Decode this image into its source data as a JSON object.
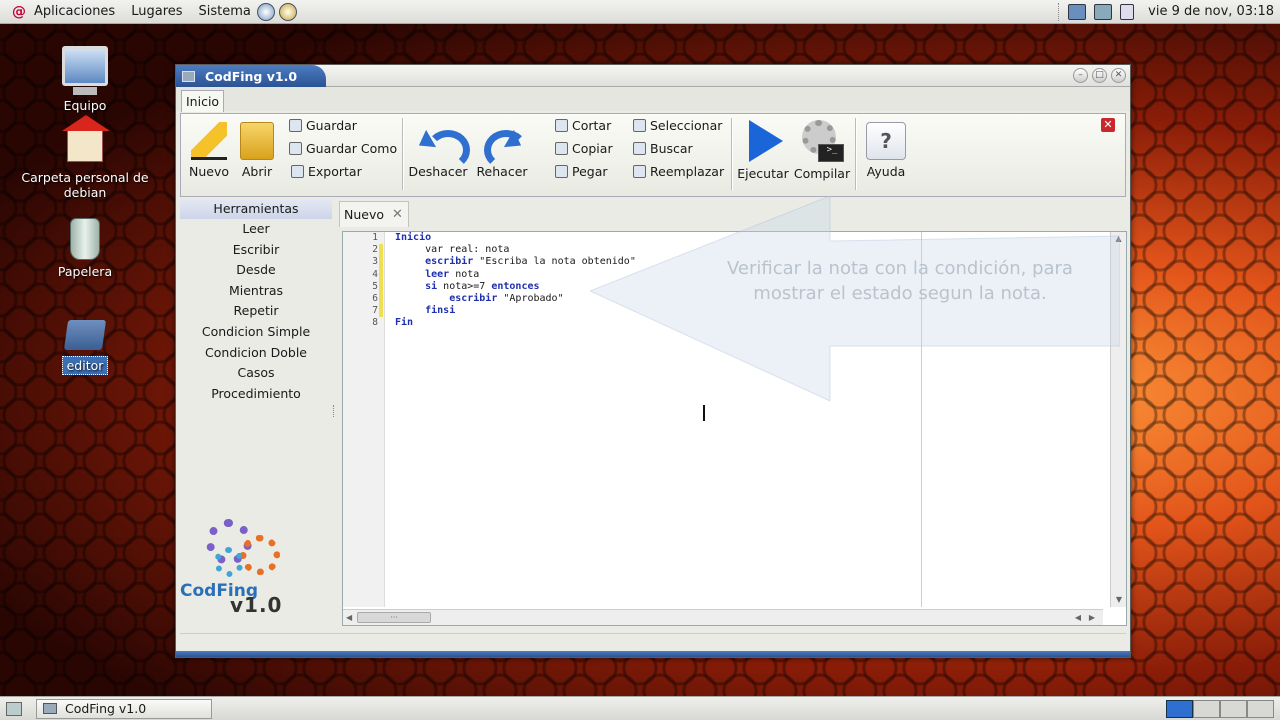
{
  "top_panel": {
    "menu_applications": "Aplicaciones",
    "menu_places": "Lugares",
    "menu_system": "Sistema",
    "clock": "vie  9 de nov, 03:18"
  },
  "desktop_icons": {
    "computer": "Equipo",
    "home": "Carpeta personal de debian",
    "trash": "Papelera",
    "editor": "editor"
  },
  "window": {
    "title": "CodFing v1.0",
    "ribbon_tab": "Inicio",
    "buttons": {
      "new": "Nuevo",
      "open": "Abrir",
      "save": "Guardar",
      "save_as": "Guardar Como",
      "export": "Exportar",
      "undo": "Deshacer",
      "redo": "Rehacer",
      "cut": "Cortar",
      "copy": "Copiar",
      "paste": "Pegar",
      "select": "Seleccionar",
      "search": "Buscar",
      "replace": "Reemplazar",
      "run": "Ejecutar",
      "compile": "Compilar",
      "help": "Ayuda"
    }
  },
  "sidebar": {
    "header": "Herramientas",
    "items": [
      {
        "label": "Leer"
      },
      {
        "label": "Escribir"
      },
      {
        "label": "Desde"
      },
      {
        "label": "Mientras"
      },
      {
        "label": "Repetir"
      },
      {
        "label": "Condicion Simple"
      },
      {
        "label": "Condicion Doble"
      },
      {
        "label": "Casos"
      },
      {
        "label": "Procedimiento"
      }
    ],
    "logo_name": "CodFing",
    "logo_version": "v1.0"
  },
  "editor": {
    "tab": "Nuevo",
    "line_numbers": [
      "1",
      "2",
      "3",
      "4",
      "5",
      "6",
      "7",
      "8"
    ],
    "lines": [
      [
        {
          "t": "Inicio",
          "k": true
        }
      ],
      [
        {
          "t": "     var real: nota",
          "k": false
        }
      ],
      [
        {
          "t": "     ",
          "k": false
        },
        {
          "t": "escribir",
          "k": true
        },
        {
          "t": " \"Escriba la nota obtenido\"",
          "k": false
        }
      ],
      [
        {
          "t": "     ",
          "k": false
        },
        {
          "t": "leer",
          "k": true
        },
        {
          "t": " nota",
          "k": false
        }
      ],
      [
        {
          "t": "     ",
          "k": false
        },
        {
          "t": "si",
          "k": true
        },
        {
          "t": " nota>=7 ",
          "k": false
        },
        {
          "t": "entonces",
          "k": true
        }
      ],
      [
        {
          "t": "         ",
          "k": false
        },
        {
          "t": "escribir",
          "k": true
        },
        {
          "t": " \"Aprobado\"",
          "k": false
        }
      ],
      [
        {
          "t": "     ",
          "k": false
        },
        {
          "t": "finsi",
          "k": true
        }
      ],
      [
        {
          "t": "Fin",
          "k": true
        }
      ]
    ]
  },
  "callout_text": "Verificar la nota con la condición, para mostrar el estado segun la nota.",
  "taskbar": {
    "task": "CodFing v1.0"
  },
  "colors": {
    "accent": "#2b5394",
    "keyword": "#1e2fb0",
    "close_red": "#c8282a"
  }
}
